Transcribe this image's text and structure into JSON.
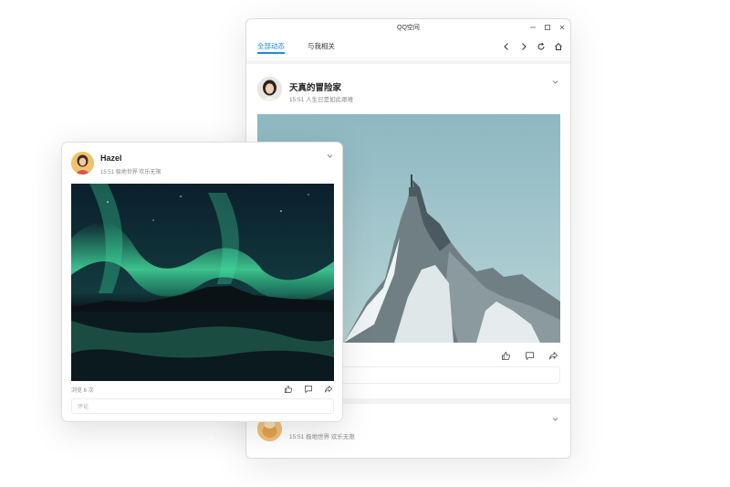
{
  "window": {
    "title": "QQ空间",
    "controls": {
      "minimize": "minimize-icon",
      "maximize": "maximize-icon",
      "close": "close-icon"
    }
  },
  "nav": {
    "tabs": [
      {
        "label": "全部动态",
        "active": true
      },
      {
        "label": "与我相关",
        "active": false
      }
    ],
    "icons": [
      "back-icon",
      "forward-icon",
      "refresh-icon",
      "home-icon"
    ]
  },
  "posts": [
    {
      "username": "天真的冒险家",
      "time": "15:51",
      "text": "人生已是如此艰难",
      "image": "snowy-mountain-peak",
      "actions": [
        "like-icon",
        "comment-icon",
        "share-icon"
      ]
    },
    {
      "username": "",
      "time": "15:51",
      "text": "极地世界 欢乐无限",
      "image": "aurora-night-sky"
    }
  ],
  "floating_post": {
    "username": "Hazel",
    "time": "15:51",
    "text": "极地世界 欢乐无限",
    "image": "aurora-over-lake",
    "views": "浏览 6 次",
    "comment_placeholder": "评论",
    "actions": [
      "like-icon",
      "comment-icon",
      "share-icon"
    ]
  },
  "colors": {
    "accent": "#1e88e5",
    "text": "#222222",
    "muted": "#888888"
  }
}
